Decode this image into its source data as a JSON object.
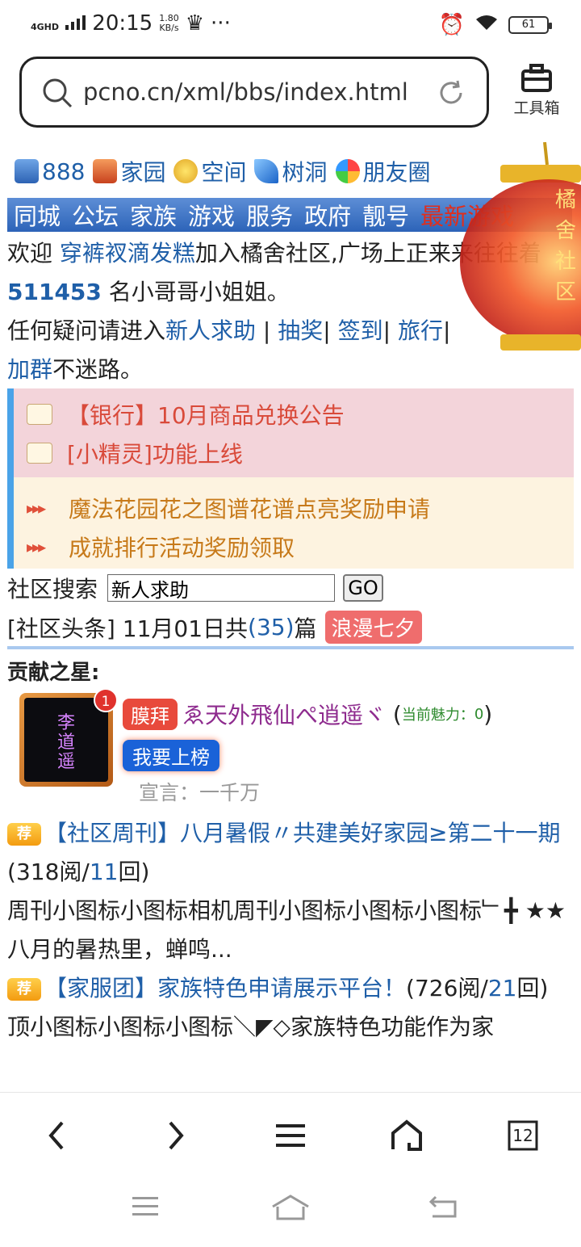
{
  "status": {
    "network": "4GHD",
    "time": "20:15",
    "speed_value": "1.80",
    "speed_unit": "KB/s",
    "battery": "61"
  },
  "browser": {
    "url": "pcno.cn/xml/bbs/index.html",
    "toolbox_label": "工具箱",
    "tab_count": "12"
  },
  "nav": {
    "count": "888",
    "items": [
      "家园",
      "空间",
      "树洞",
      "朋友圈"
    ]
  },
  "menu": {
    "items": [
      "同城",
      "公坛",
      "家族",
      "游戏",
      "服务",
      "政府",
      "靓号"
    ],
    "hot": "最新游戏"
  },
  "welcome": {
    "prefix": "欢迎 ",
    "user": "穿裤衩滴发糕",
    "mid": "加入橘舍社区,广场上正来来往往着 ",
    "count": "511453",
    "suffix": " 名小哥哥小姐姐。",
    "help_prefix": "任何疑问请进入",
    "link_help": "新人求助",
    "link_lottery": "抽奖",
    "link_checkin": "签到",
    "link_travel": "旅行",
    "link_group": "加群",
    "end": "不迷路。"
  },
  "notices": {
    "pink": [
      "【银行】10月商品兑换公告",
      "[小精灵]功能上线"
    ],
    "cream": [
      "魔法花园花之图谱花谱点亮奖励申请",
      "成就排行活动奖励领取"
    ]
  },
  "search": {
    "label": "社区搜索",
    "value": "新人求助",
    "button": "GO"
  },
  "headline": {
    "prefix": "[社区头条] 11月01日共",
    "count": "(35)",
    "suffix": "篇",
    "tag": "浪漫七夕"
  },
  "star": {
    "title": "贡献之星:",
    "badge": "1",
    "avatar_text": "李\n道\n遥",
    "worship": "膜拜",
    "nick": "ゑ天外飛仙ぺ逍遥ヾ",
    "charm_label": "当前魅力：",
    "charm_value": "0",
    "rank_button": "我要上榜",
    "motto": "宣言：一千万"
  },
  "posts": [
    {
      "rec": "荐",
      "title": "【社区周刊】八月暑假〃共建美好家园≥第二十一期",
      "reads": "318阅",
      "replies": "11",
      "reply_unit": "回",
      "excerpt": "周刊小图标小图标相机周刊小图标小图标小图标﹂╋ ★★八月的暑热里，蝉鸣..."
    },
    {
      "rec": "荐",
      "title": "【家服团】家族特色申请展示平台！",
      "reads": "726阅",
      "replies": "21",
      "reply_unit": "回",
      "excerpt": "顶小图标小图标小图标＼◤◇家族特色功能作为家"
    }
  ],
  "lantern": {
    "text": "橘舍社区"
  },
  "colors": {
    "link": "#1f5fa8",
    "menu": "#2c63b8",
    "hot": "#e02e1c",
    "pink_bg": "#f3d4da",
    "cream_bg": "#fdf3e0"
  }
}
